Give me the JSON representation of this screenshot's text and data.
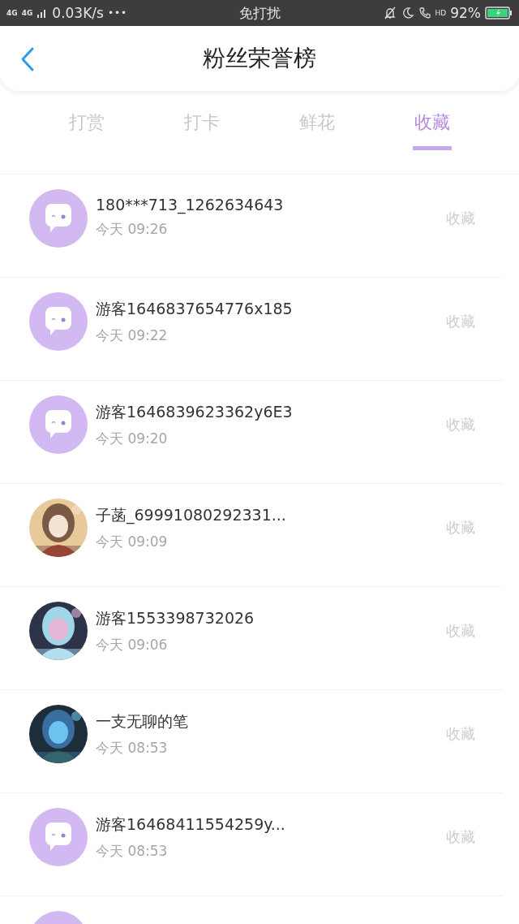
{
  "status_bar": {
    "network": "4G",
    "network_2": "4G",
    "speed": "0.03K/s",
    "more": "•••",
    "mode": "免打扰",
    "hd": "HD",
    "battery": "92%"
  },
  "header": {
    "title": "粉丝荣誉榜"
  },
  "tabs": [
    {
      "label": "打赏",
      "selected": false
    },
    {
      "label": "打卡",
      "selected": false
    },
    {
      "label": "鲜花",
      "selected": false
    },
    {
      "label": "收藏",
      "selected": true
    }
  ],
  "rows": [
    {
      "kind": "default",
      "name": "180***713_1262634643",
      "time": "今天 09:26",
      "action": "收藏"
    },
    {
      "kind": "default",
      "name": "游客1646837654776x185",
      "time": "今天 09:22",
      "action": "收藏"
    },
    {
      "kind": "default",
      "name": "游客1646839623362y6E3",
      "time": "今天 09:20",
      "action": "收藏"
    },
    {
      "kind": "picture",
      "name": "子菡_69991080292331...",
      "time": "今天 09:09",
      "action": "收藏"
    },
    {
      "kind": "picture",
      "name": "游客1553398732026",
      "time": "今天 09:06",
      "action": "收藏"
    },
    {
      "kind": "picture",
      "name": "一支无聊的笔",
      "time": "今天 08:53",
      "action": "收藏"
    },
    {
      "kind": "default",
      "name": "游客16468411554259y...",
      "time": "今天 08:53",
      "action": "收藏"
    },
    {
      "kind": "default"
    }
  ]
}
